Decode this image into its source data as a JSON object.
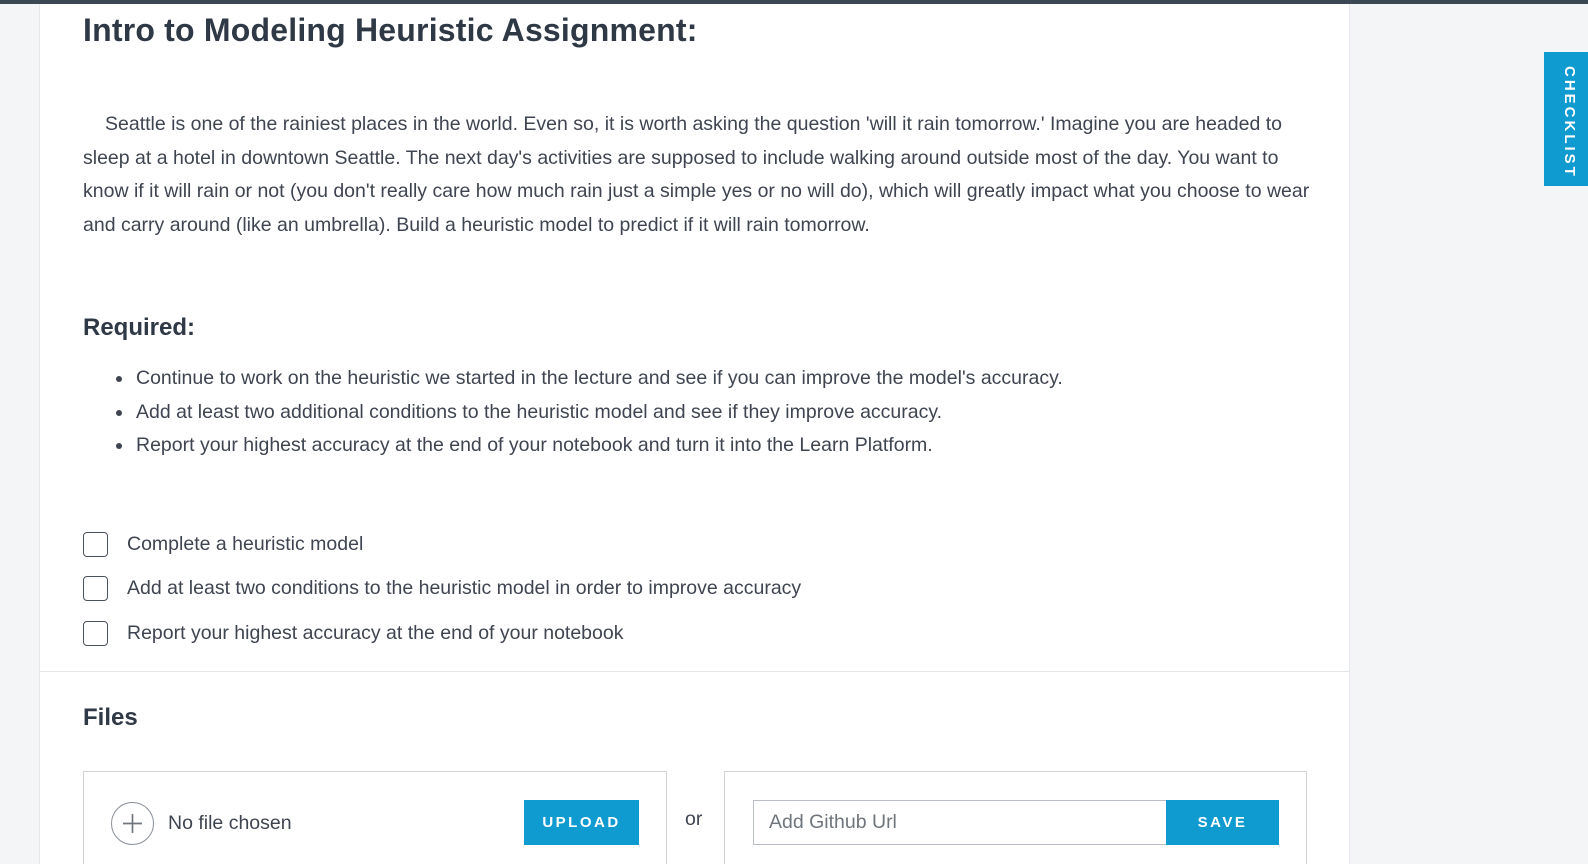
{
  "assignment": {
    "title": "Intro to Modeling Heuristic Assignment:",
    "intro": "Seattle is one of the rainiest places in the world. Even so, it is worth asking the question 'will it rain tomorrow.' Imagine you are headed to sleep at a hotel in downtown Seattle. The next day's activities are supposed to include walking around outside most of the day. You want to know if it will rain or not (you don't really care how much rain just a simple yes or no will do), which will greatly impact what you choose to wear and carry around (like an umbrella). Build a heuristic model to predict if it will rain tomorrow."
  },
  "required": {
    "heading": "Required:",
    "items": [
      "Continue to work on the heuristic we started in the lecture and see if you can improve the model's accuracy.",
      "Add at least two additional conditions to the heuristic model and see if they improve accuracy.",
      "Report your highest accuracy at the end of your notebook and turn it into the Learn Platform."
    ]
  },
  "checklist": {
    "items": [
      {
        "label": "Complete a heuristic model",
        "checked": false
      },
      {
        "label": "Add at least two conditions to the heuristic model in order to improve accuracy",
        "checked": false
      },
      {
        "label": "Report your highest accuracy at the end of your notebook",
        "checked": false
      }
    ]
  },
  "files": {
    "heading": "Files",
    "no_file_text": "No file chosen",
    "upload_label": "UPLOAD",
    "or_text": "or",
    "github_placeholder": "Add Github Url",
    "save_label": "SAVE"
  },
  "side_tab": {
    "label": "CHECKLIST"
  },
  "colors": {
    "accent": "#0f9ad0",
    "heading": "#2f3945",
    "text": "#3f4550",
    "background": "#f4f5f7"
  },
  "icons": {
    "add_file": "plus-circle-icon"
  }
}
